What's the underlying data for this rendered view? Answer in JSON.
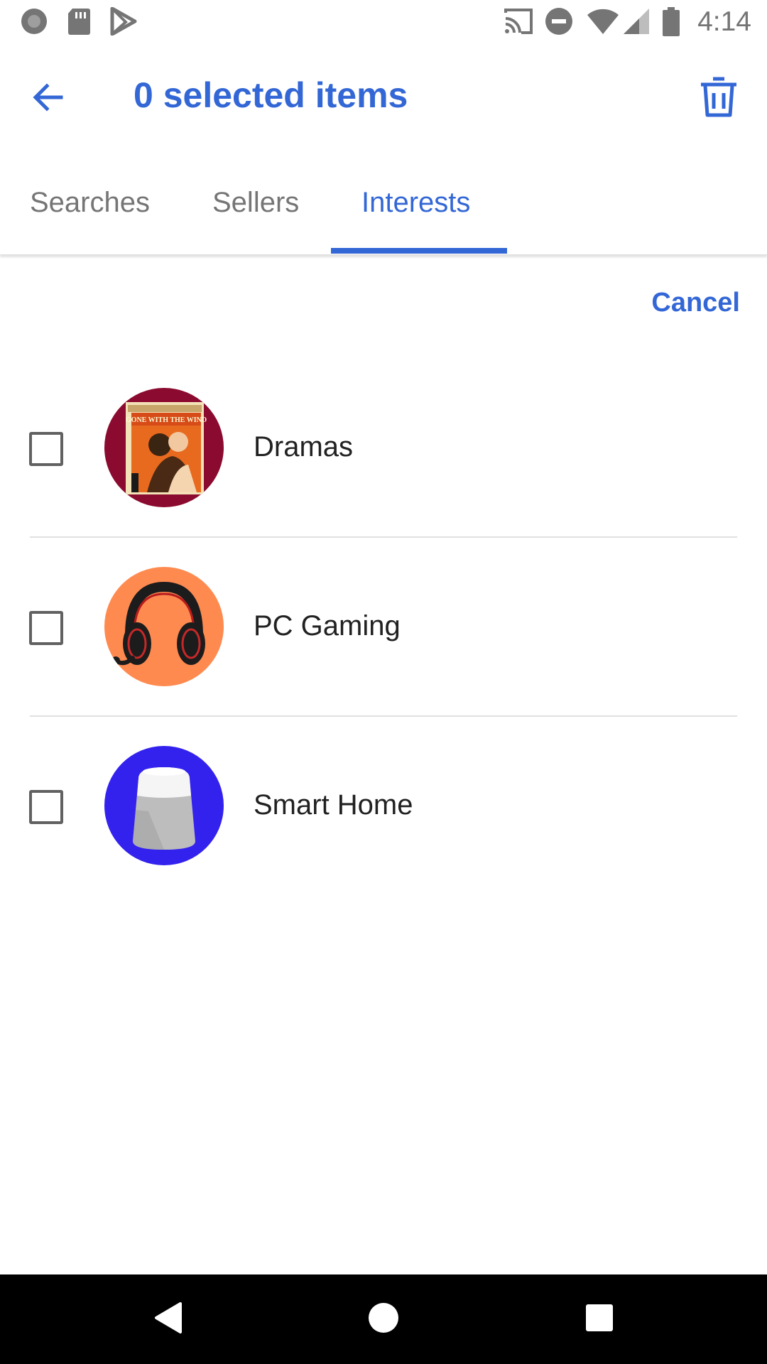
{
  "status_bar": {
    "time": "4:14",
    "icons": [
      "notification-circle-icon",
      "sd-card-icon",
      "play-store-icon",
      "cast-icon",
      "do-not-disturb-icon",
      "wifi-icon",
      "signal-icon",
      "battery-icon"
    ]
  },
  "app_bar": {
    "title": "0 selected items",
    "back_icon": "arrow-back-icon",
    "delete_icon": "trash-icon"
  },
  "tabs": [
    {
      "label": "Searches",
      "active": false
    },
    {
      "label": "Sellers",
      "active": false
    },
    {
      "label": "Interests",
      "active": true
    }
  ],
  "cancel_label": "Cancel",
  "items": [
    {
      "label": "Dramas",
      "checked": false,
      "avatar_color": "#8b0a2f",
      "image": "gone-with-the-wind-dvd"
    },
    {
      "label": "PC Gaming",
      "checked": false,
      "avatar_color": "#ff8a50",
      "image": "gaming-headset"
    },
    {
      "label": "Smart Home",
      "checked": false,
      "avatar_color": "#3322ee",
      "image": "smart-speaker"
    }
  ],
  "dvd_cover_text": "GONE WITH THE WIND",
  "colors": {
    "accent": "#3367d6",
    "text_primary": "#212121",
    "text_secondary": "#757575",
    "nav_bar": "#000000"
  },
  "nav_bar": {
    "icons": [
      "nav-back-icon",
      "nav-home-icon",
      "nav-recents-icon"
    ]
  }
}
